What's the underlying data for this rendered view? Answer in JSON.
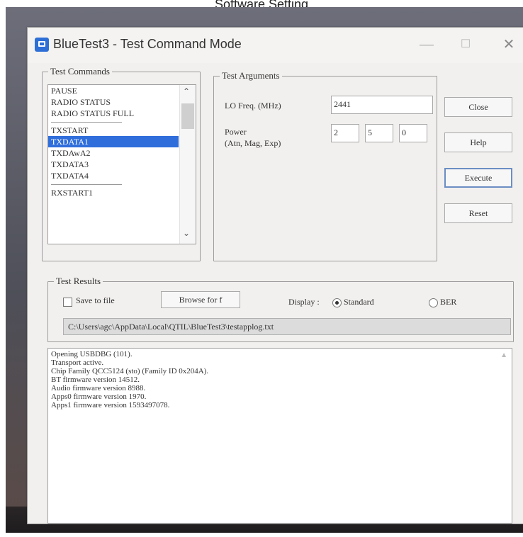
{
  "page_caption": "Software Setting",
  "window": {
    "title": "BlueTest3 - Test Command Mode",
    "minimize_glyph": "—",
    "maximize_glyph": "☐",
    "close_glyph": "✕",
    "icon": "app-icon"
  },
  "test_commands": {
    "legend": "Test Commands",
    "items": [
      {
        "label": "PAUSE"
      },
      {
        "label": "RADIO STATUS"
      },
      {
        "label": "RADIO STATUS FULL"
      },
      {
        "separator": true
      },
      {
        "label": "TXSTART"
      },
      {
        "label": "TXDATA1",
        "selected": true
      },
      {
        "label": "TXDAwA2"
      },
      {
        "label": "TXDATA3"
      },
      {
        "label": "TXDATA4"
      },
      {
        "separator": true
      },
      {
        "label": "RXSTART1"
      }
    ]
  },
  "test_arguments": {
    "legend": "Test Arguments",
    "lo_freq_label": "LO Freq. (MHz)",
    "lo_freq_value": "2441",
    "power_label_line1": "Power",
    "power_label_line2": "(Atn, Mag, Exp)",
    "power_values": [
      "2",
      "5",
      "0"
    ]
  },
  "buttons": {
    "close": "Close",
    "help": "Help",
    "execute": "Execute",
    "reset": "Reset"
  },
  "test_results": {
    "legend": "Test Results",
    "save_to_file_label": "Save to file",
    "save_to_file_checked": false,
    "browse_label": "Browse for f",
    "display_label": "Display :",
    "display_options": [
      "Standard",
      "BER"
    ],
    "display_selected": "Standard",
    "file_path": "C:\\Users\\agc\\AppData\\Local\\QTIL\\BlueTest3\\testapplog.txt"
  },
  "log": {
    "lines": [
      "Opening USBDBG (101).",
      "Transport active.",
      "Chip Family QCC5124 (sto) (Family ID 0x204A).",
      "BT firmware version 14512.",
      "Audio firmware version 8988.",
      "Apps0 firmware version 1970.",
      "Apps1 firmware version 1593497078."
    ]
  }
}
